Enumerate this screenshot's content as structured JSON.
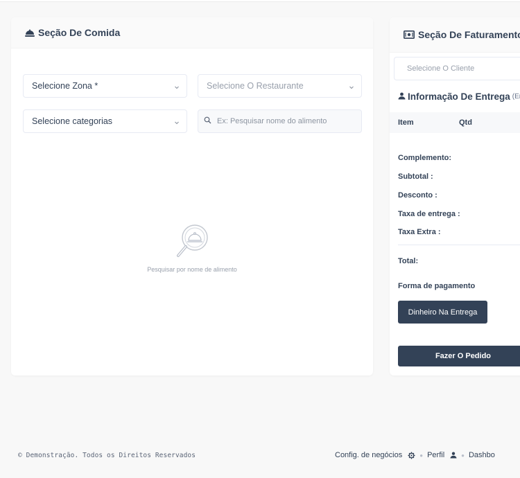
{
  "food_section": {
    "title": "Seção De Comida",
    "zone_select": "Selecione Zona *",
    "restaurant_select": "Selecione O Restaurante",
    "category_select": "Selecione categorias",
    "search_placeholder": "Ex: Pesquisar nome do alimento",
    "empty_text": "Pesquisar por nome de alimento"
  },
  "billing_section": {
    "title": "Seção De Faturamento",
    "client_select": "Selecione O Cliente",
    "delivery_title": "Informação De Entrega",
    "delivery_note": "(En",
    "table_headers": [
      "Item",
      "Qtd"
    ],
    "summary": {
      "complement": "Complemento:",
      "subtotal": "Subtotal :",
      "discount": "Desconto :",
      "delivery_fee": "Taxa de entrega :",
      "extra_fee": "Taxa Extra :",
      "total": "Total:"
    },
    "payment_label": "Forma de pagamento",
    "payment_button": "Dinheiro Na Entrega",
    "order_button": "Fazer O Pedido"
  },
  "footer": {
    "copyright": "© Demonstração. Todos os Direitos Reservados",
    "links": [
      "Config. de negócios",
      "Perfil",
      "Dashbo"
    ]
  },
  "colors": {
    "primary": "#334257",
    "muted_text": "#99a0ac",
    "border": "#e7eaf3"
  }
}
